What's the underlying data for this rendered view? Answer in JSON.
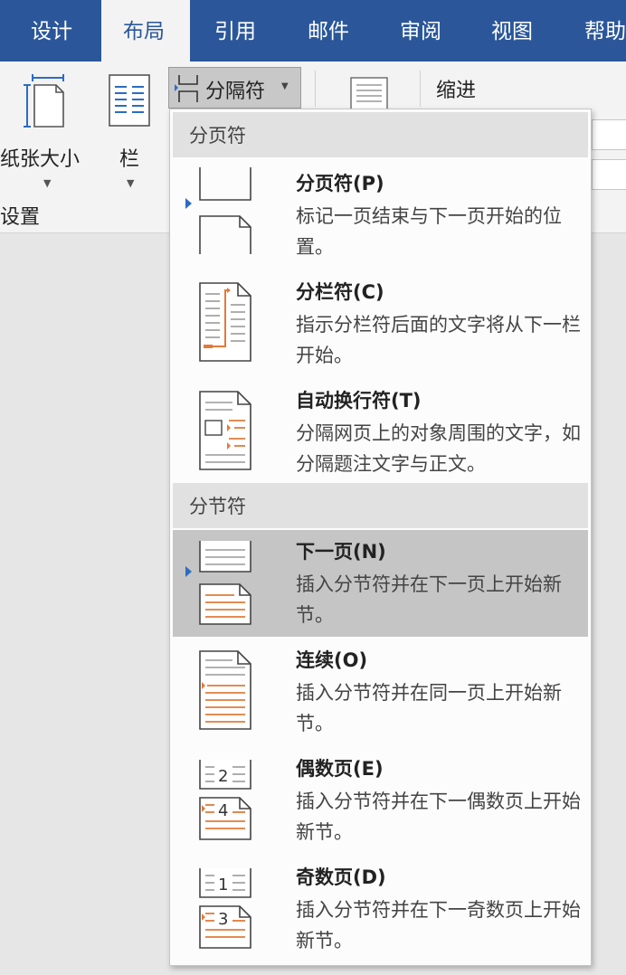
{
  "tabs": [
    "设计",
    "布局",
    "引用",
    "邮件",
    "审阅",
    "视图",
    "帮助"
  ],
  "ribbon": {
    "paper_size_label": "纸张大小",
    "columns_label": "栏",
    "page_setup_group": "设置",
    "breaks_label": "分隔符",
    "indent_label": "缩进"
  },
  "menu": {
    "page_breaks_header": "分页符",
    "section_breaks_header": "分节符",
    "items": [
      {
        "title": "分页符(P)",
        "desc": "标记一页结束与下一页开始的位置。",
        "icon": "page-break-icon"
      },
      {
        "title": "分栏符(C)",
        "desc": "指示分栏符后面的文字将从下一栏开始。",
        "icon": "column-break-icon"
      },
      {
        "title": "自动换行符(T)",
        "desc": "分隔网页上的对象周围的文字，如分隔题注文字与正文。",
        "icon": "text-wrapping-break-icon"
      },
      {
        "title": "下一页(N)",
        "desc": "插入分节符并在下一页上开始新节。",
        "icon": "next-page-section-icon"
      },
      {
        "title": "连续(O)",
        "desc": "插入分节符并在同一页上开始新节。",
        "icon": "continuous-section-icon"
      },
      {
        "title": "偶数页(E)",
        "desc": "插入分节符并在下一偶数页上开始新节。",
        "icon": "even-page-section-icon"
      },
      {
        "title": "奇数页(D)",
        "desc": "插入分节符并在下一奇数页上开始新节。",
        "icon": "odd-page-section-icon"
      }
    ],
    "selected_item": "下一页(N)"
  },
  "colors": {
    "tab_bar": "#2b579a",
    "accent_orange": "#e07b39",
    "selected_row": "#c5c5c5"
  }
}
